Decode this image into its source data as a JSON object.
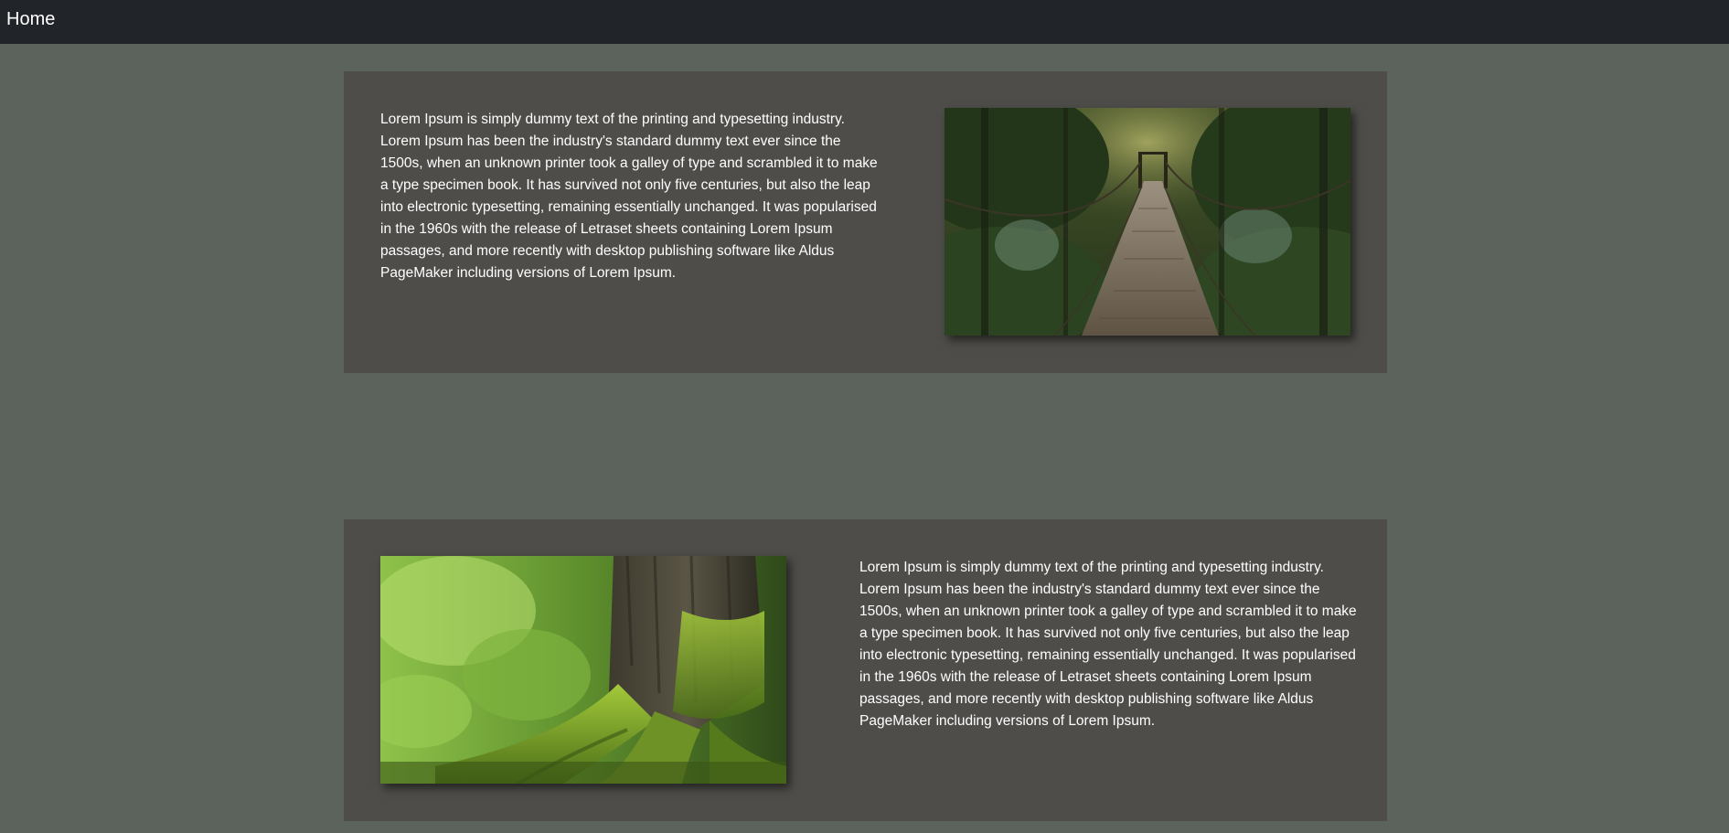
{
  "navbar": {
    "home_label": "Home"
  },
  "sections": [
    {
      "text": "Lorem Ipsum is simply dummy text of the printing and typesetting industry. Lorem Ipsum has been the industry's standard dummy text ever since the 1500s, when an unknown printer took a galley of type and scrambled it to make a type specimen book. It has survived not only five centuries, but also the leap into electronic typesetting, remaining essentially unchanged. It was popularised in the 1960s with the release of Letraset sheets containing Lorem Ipsum passages, and more recently with desktop publishing software like Aldus PageMaker including versions of Lorem Ipsum.",
      "image": "forest-suspension-bridge-photo"
    },
    {
      "text": "Lorem Ipsum is simply dummy text of the printing and typesetting industry. Lorem Ipsum has been the industry's standard dummy text ever since the 1500s, when an unknown printer took a galley of type and scrambled it to make a type specimen book. It has survived not only five centuries, but also the leap into electronic typesetting, remaining essentially unchanged. It was popularised in the 1960s with the release of Letraset sheets containing Lorem Ipsum passages, and more recently with desktop publishing software like Aldus PageMaker including versions of Lorem Ipsum.",
      "image": "mossy-tree-roots-photo"
    }
  ],
  "colors": {
    "page_background": "#5b635c",
    "navbar_background": "#212529",
    "card_background": "#4e4d49",
    "text": "#ffffff"
  }
}
